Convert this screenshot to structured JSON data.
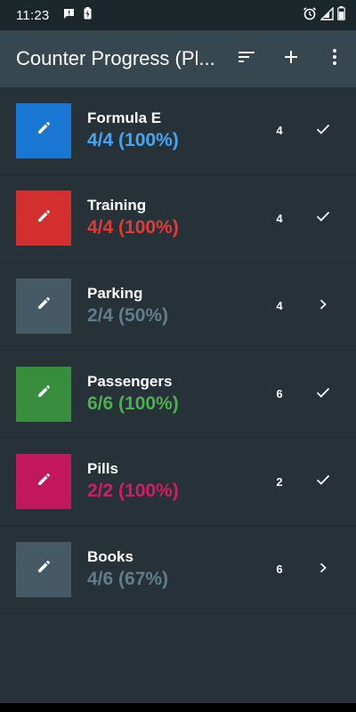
{
  "status_bar": {
    "time": "11:23",
    "left_icons": [
      "message-icon",
      "battery-charging-small-icon"
    ],
    "right_icons": [
      "alarm-icon",
      "signal-icon",
      "battery-icon"
    ]
  },
  "app_bar": {
    "title": "Counter Progress (Pl...",
    "actions": [
      "sort-icon",
      "add-icon",
      "more-vert-icon"
    ]
  },
  "counters": [
    {
      "name": "Formula E",
      "progress": "4/4 (100%)",
      "count": "4",
      "color": "#1976d2",
      "progress_color": "#42a5f5",
      "action": "check"
    },
    {
      "name": "Training",
      "progress": "4/4 (100%)",
      "count": "4",
      "color": "#d32f2f",
      "progress_color": "#e53935",
      "action": "check"
    },
    {
      "name": "Parking",
      "progress": "2/4 (50%)",
      "count": "4",
      "color": "#455a64",
      "progress_color": "#607d8b",
      "action": "chevron"
    },
    {
      "name": "Passengers",
      "progress": "6/6 (100%)",
      "count": "6",
      "color": "#388e3c",
      "progress_color": "#4caf50",
      "action": "check"
    },
    {
      "name": "Pills",
      "progress": "2/2 (100%)",
      "count": "2",
      "color": "#c2185b",
      "progress_color": "#d81b60",
      "action": "check"
    },
    {
      "name": "Books",
      "progress": "4/6 (67%)",
      "count": "6",
      "color": "#455a64",
      "progress_color": "#607d8b",
      "action": "chevron"
    }
  ],
  "colors": {
    "background": "#263238",
    "app_bar": "#37474f",
    "status_bar": "#1c272c"
  }
}
